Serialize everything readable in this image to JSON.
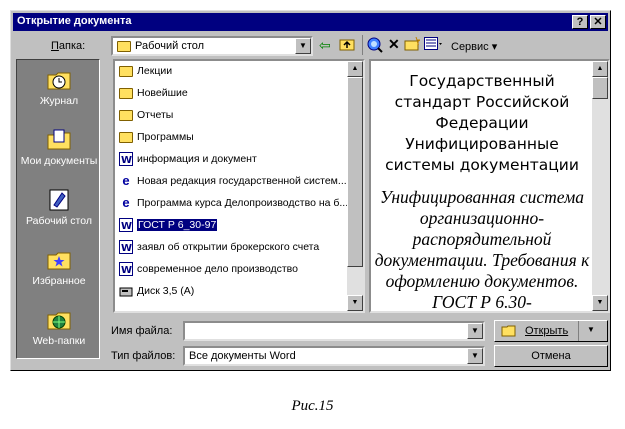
{
  "window": {
    "title": "Открытие документа",
    "help_btn": "?",
    "close_btn": "✕"
  },
  "toolbar": {
    "folder_label": "Папка:",
    "folder_value": "Рабочий стол",
    "service_label": "Сервис"
  },
  "places": [
    {
      "label": "Журнал",
      "icon": "history-icon"
    },
    {
      "label": "Мои документы",
      "icon": "my-documents-icon"
    },
    {
      "label": "Рабочий стол",
      "icon": "desktop-icon"
    },
    {
      "label": "Избранное",
      "icon": "favorites-icon"
    },
    {
      "label": "Web-папки",
      "icon": "web-folders-icon"
    }
  ],
  "files": [
    {
      "name": "Лекции",
      "icon": "folder-icon",
      "selected": false
    },
    {
      "name": "Новейшие",
      "icon": "folder-icon",
      "selected": false
    },
    {
      "name": "Отчеты",
      "icon": "folder-icon",
      "selected": false
    },
    {
      "name": "Программы",
      "icon": "folder-icon",
      "selected": false
    },
    {
      "name": "информация и документ",
      "icon": "word-doc-icon",
      "selected": false
    },
    {
      "name": "Новая редакция государственной систем...",
      "icon": "html-doc-icon",
      "selected": false
    },
    {
      "name": "Программа курса Делопроизводство на б...",
      "icon": "html-doc-icon",
      "selected": false
    },
    {
      "name": "ГОСТ Р 6_30-97",
      "icon": "word-doc-icon",
      "selected": true
    },
    {
      "name": "заявл об открытии брокерского счета",
      "icon": "word-doc-icon",
      "selected": false
    },
    {
      "name": "современное дело производство",
      "icon": "word-doc-icon",
      "selected": false
    },
    {
      "name": "Диск 3,5 (A)",
      "icon": "floppy-drive-icon",
      "selected": false
    }
  ],
  "preview": {
    "heading": "Государственный стандарт Российской Федерации Унифицированные системы документации",
    "body": "Унифицированная система организационно-распорядительной документации. Требования к оформлению документов. ГОСТ Р 6.30-"
  },
  "bottom": {
    "filename_label": "Имя файла:",
    "filename_value": "",
    "filetype_label": "Тип файлов:",
    "filetype_value": "Все документы Word",
    "open_btn": "Открыть",
    "cancel_btn": "Отмена"
  },
  "caption": "Рис.15"
}
